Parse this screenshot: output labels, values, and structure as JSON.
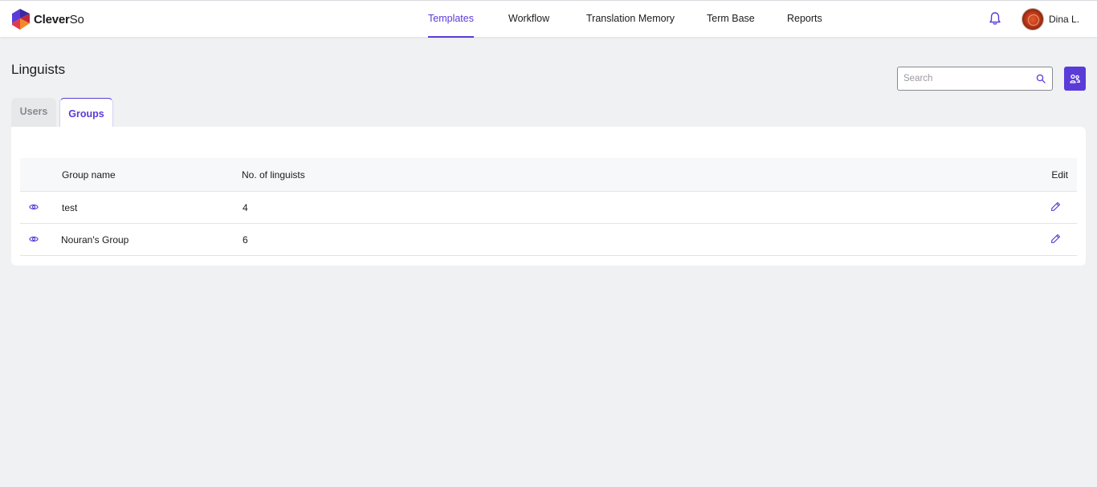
{
  "app": {
    "logo_bold": "Clever",
    "logo_light": "So"
  },
  "nav": {
    "items": [
      {
        "label": "Templates",
        "active": true
      },
      {
        "label": "Workflow",
        "active": false
      },
      {
        "label": "Translation Memory",
        "active": false
      },
      {
        "label": "Term Base",
        "active": false
      },
      {
        "label": "Reports",
        "active": false
      }
    ]
  },
  "user": {
    "name": "Dina L."
  },
  "page": {
    "title": "Linguists",
    "search_placeholder": "Search",
    "tabs": [
      {
        "label": "Users",
        "active": false
      },
      {
        "label": "Groups",
        "active": true
      }
    ]
  },
  "table": {
    "headers": {
      "group_name": "Group name",
      "linguists": "No. of linguists",
      "edit": "Edit"
    },
    "rows": [
      {
        "name": "test",
        "count": "4"
      },
      {
        "name": "Nouran's Group",
        "count": "6"
      }
    ]
  },
  "colors": {
    "accent": "#5b3bd8",
    "background": "#eff1f2",
    "card": "#ffffff"
  },
  "icons": [
    "logo-mark",
    "bell-icon",
    "search-icon",
    "settings-icon",
    "eye-icon",
    "pencil-icon"
  ]
}
